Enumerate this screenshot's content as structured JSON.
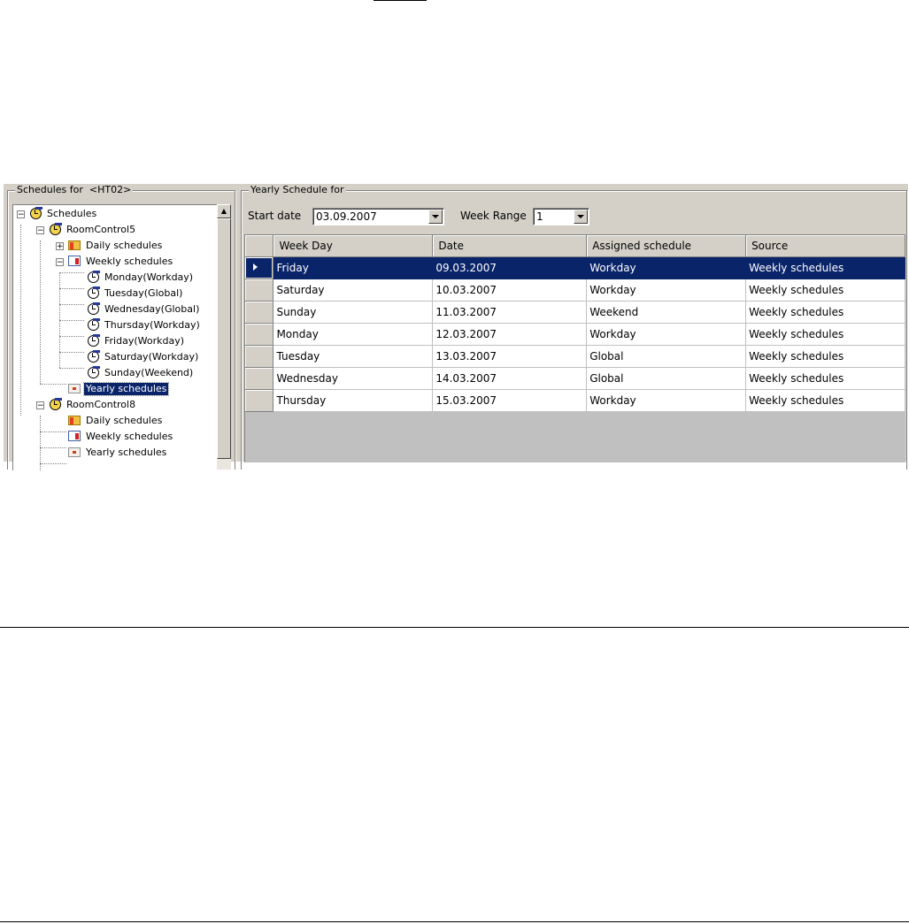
{
  "left_panel": {
    "title": "Schedules for  <HT02>",
    "tree": {
      "root": "Schedules",
      "room5": {
        "label": "RoomControl5",
        "daily": "Daily schedules",
        "weekly": "Weekly schedules",
        "weekly_items": [
          "Monday(Workday)",
          "Tuesday(Global)",
          "Wednesday(Global)",
          "Thursday(Workday)",
          "Friday(Workday)",
          "Saturday(Workday)",
          "Sunday(Weekend)"
        ],
        "yearly": "Yearly schedules"
      },
      "room8": {
        "label": "RoomControl8",
        "daily": "Daily schedules",
        "weekly": "Weekly schedules",
        "yearly": "Yearly schedules"
      }
    }
  },
  "right_panel": {
    "title": "Yearly Schedule for",
    "start_date_label": "Start date",
    "start_date_value": "03.09.2007",
    "week_range_label": "Week Range",
    "week_range_value": "1",
    "table": {
      "columns": [
        "Week Day",
        "Date",
        "Assigned schedule",
        "Source"
      ],
      "rows": [
        [
          "Friday",
          "09.03.2007",
          "Workday",
          "Weekly schedules"
        ],
        [
          "Saturday",
          "10.03.2007",
          "Workday",
          "Weekly schedules"
        ],
        [
          "Sunday",
          "11.03.2007",
          "Weekend",
          "Weekly schedules"
        ],
        [
          "Monday",
          "12.03.2007",
          "Workday",
          "Weekly schedules"
        ],
        [
          "Tuesday",
          "13.03.2007",
          "Global",
          "Weekly schedules"
        ],
        [
          "Wednesday",
          "14.03.2007",
          "Global",
          "Weekly schedules"
        ],
        [
          "Thursday",
          "15.03.2007",
          "Workday",
          "Weekly schedules"
        ]
      ]
    }
  },
  "colors": {
    "selection": "#0a246a",
    "panel": "#d4d0c8"
  }
}
